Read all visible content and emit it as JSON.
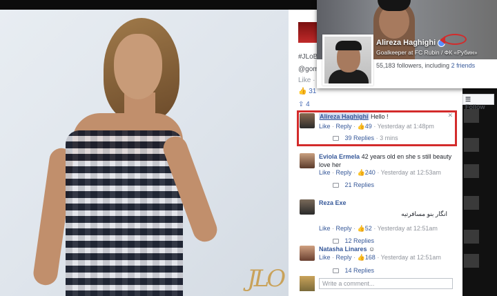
{
  "hovercard": {
    "name": "Alireza Haghighi",
    "subtitle": "Goalkeeper at FC Rubin / ФК «Рубин»",
    "followers_text": "55,183 followers, including",
    "friends_link": "2 friends"
  },
  "follow_button": "Follow",
  "post": {
    "caption_tag": "#JLoB",
    "caption_handle": "@gomi",
    "like_label": "Like",
    "like_suffix": "· C",
    "like_count": "31",
    "share_count": "4"
  },
  "comments": [
    {
      "name": "Alireza Haghighi",
      "text": "Hello !",
      "like": "Like",
      "reply": "Reply",
      "likes": "49",
      "time": "Yesterday at 1:48pm",
      "replies": "39 Replies",
      "replies_time": "3 mins"
    },
    {
      "name": "Eviola Ermela",
      "text": "42 years old en she s still beauty love her",
      "like": "Like",
      "reply": "Reply",
      "likes": "240",
      "time": "Yesterday at 12:53am",
      "replies": "21 Replies"
    },
    {
      "name": "Reza Exe",
      "text": "انگار بنو مسافرتیه",
      "like": "Like",
      "reply": "Reply",
      "likes": "52",
      "time": "Yesterday at 12:51am",
      "replies": "12 Replies"
    },
    {
      "name": "Natasha Linares",
      "text": "",
      "like": "Like",
      "reply": "Reply",
      "likes": "168",
      "time": "Yesterday at 12:51am",
      "replies": "14 Replies"
    }
  ],
  "write_comment_placeholder": "Write a comment...",
  "photo_logo": "JLO"
}
